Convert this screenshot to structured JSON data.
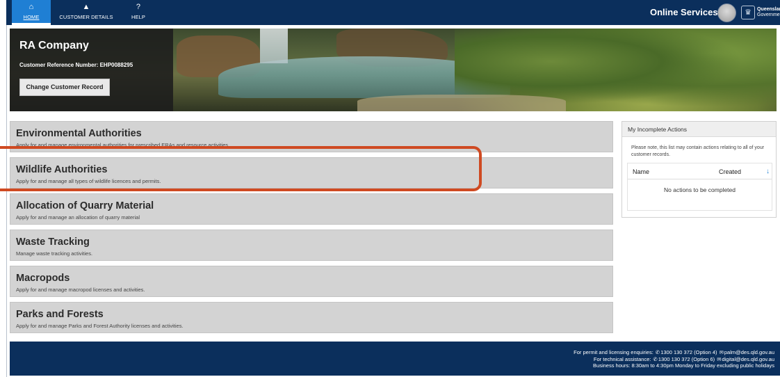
{
  "nav": {
    "items": [
      {
        "label": "HOME",
        "icon": "home-icon",
        "glyph": "⌂"
      },
      {
        "label": "CUSTOMER DETAILS",
        "icon": "person-icon",
        "glyph": "▲"
      },
      {
        "label": "HELP",
        "icon": "help-icon",
        "glyph": "?"
      }
    ],
    "active": "HOME",
    "online_services": "Online Services",
    "caret": "▼",
    "logo_text": "Queenslan Governmen",
    "logo_line1": "Queenslan",
    "logo_line2": "Governmen"
  },
  "hero": {
    "company": "RA Company",
    "customer_ref": "Customer Reference Number: EHP0088295",
    "change_button": "Change Customer Record"
  },
  "services": [
    {
      "title": "Environmental Authorities",
      "description": "Apply for and manage environmental authorities for prescribed ERAs and resource activities."
    },
    {
      "title": "Wildlife Authorities",
      "description": "Apply for and manage all types of wildlife licences and permits."
    },
    {
      "title": "Allocation of Quarry Material",
      "description": "Apply for and manage an allocation of quarry material"
    },
    {
      "title": "Waste Tracking",
      "description": "Manage waste tracking activities."
    },
    {
      "title": "Macropods",
      "description": "Apply for and manage macropod licenses and activities."
    },
    {
      "title": "Parks and Forests",
      "description": "Apply for and manage Parks and Forest Authority licenses and activities."
    }
  ],
  "incomplete_actions": {
    "title": "My Incomplete Actions",
    "note": "Please note, this list may contain actions relating to all of your customer records.",
    "col_name": "Name",
    "col_created": "Created",
    "sort_glyph": "↓",
    "empty": "No actions to be completed"
  },
  "footer": {
    "line1_prefix": "For permit and licensing enquiries:",
    "line1_phone": "1300 130 372 (Option 4)",
    "line1_email": "palm@des.qld.gov.au",
    "line2_prefix": "For technical assistance:",
    "line2_phone": "1300 130 372 (Option 6)",
    "line2_email": "digital@des.qld.gov.au",
    "line3": "Business hours: 8:30am to 4:30pm Monday to Friday excluding public holidays"
  },
  "colors": {
    "navy": "#0b2f5c",
    "active_tab": "#1f7fd4",
    "highlight": "#cf4a22",
    "card": "#d3d3d3"
  }
}
